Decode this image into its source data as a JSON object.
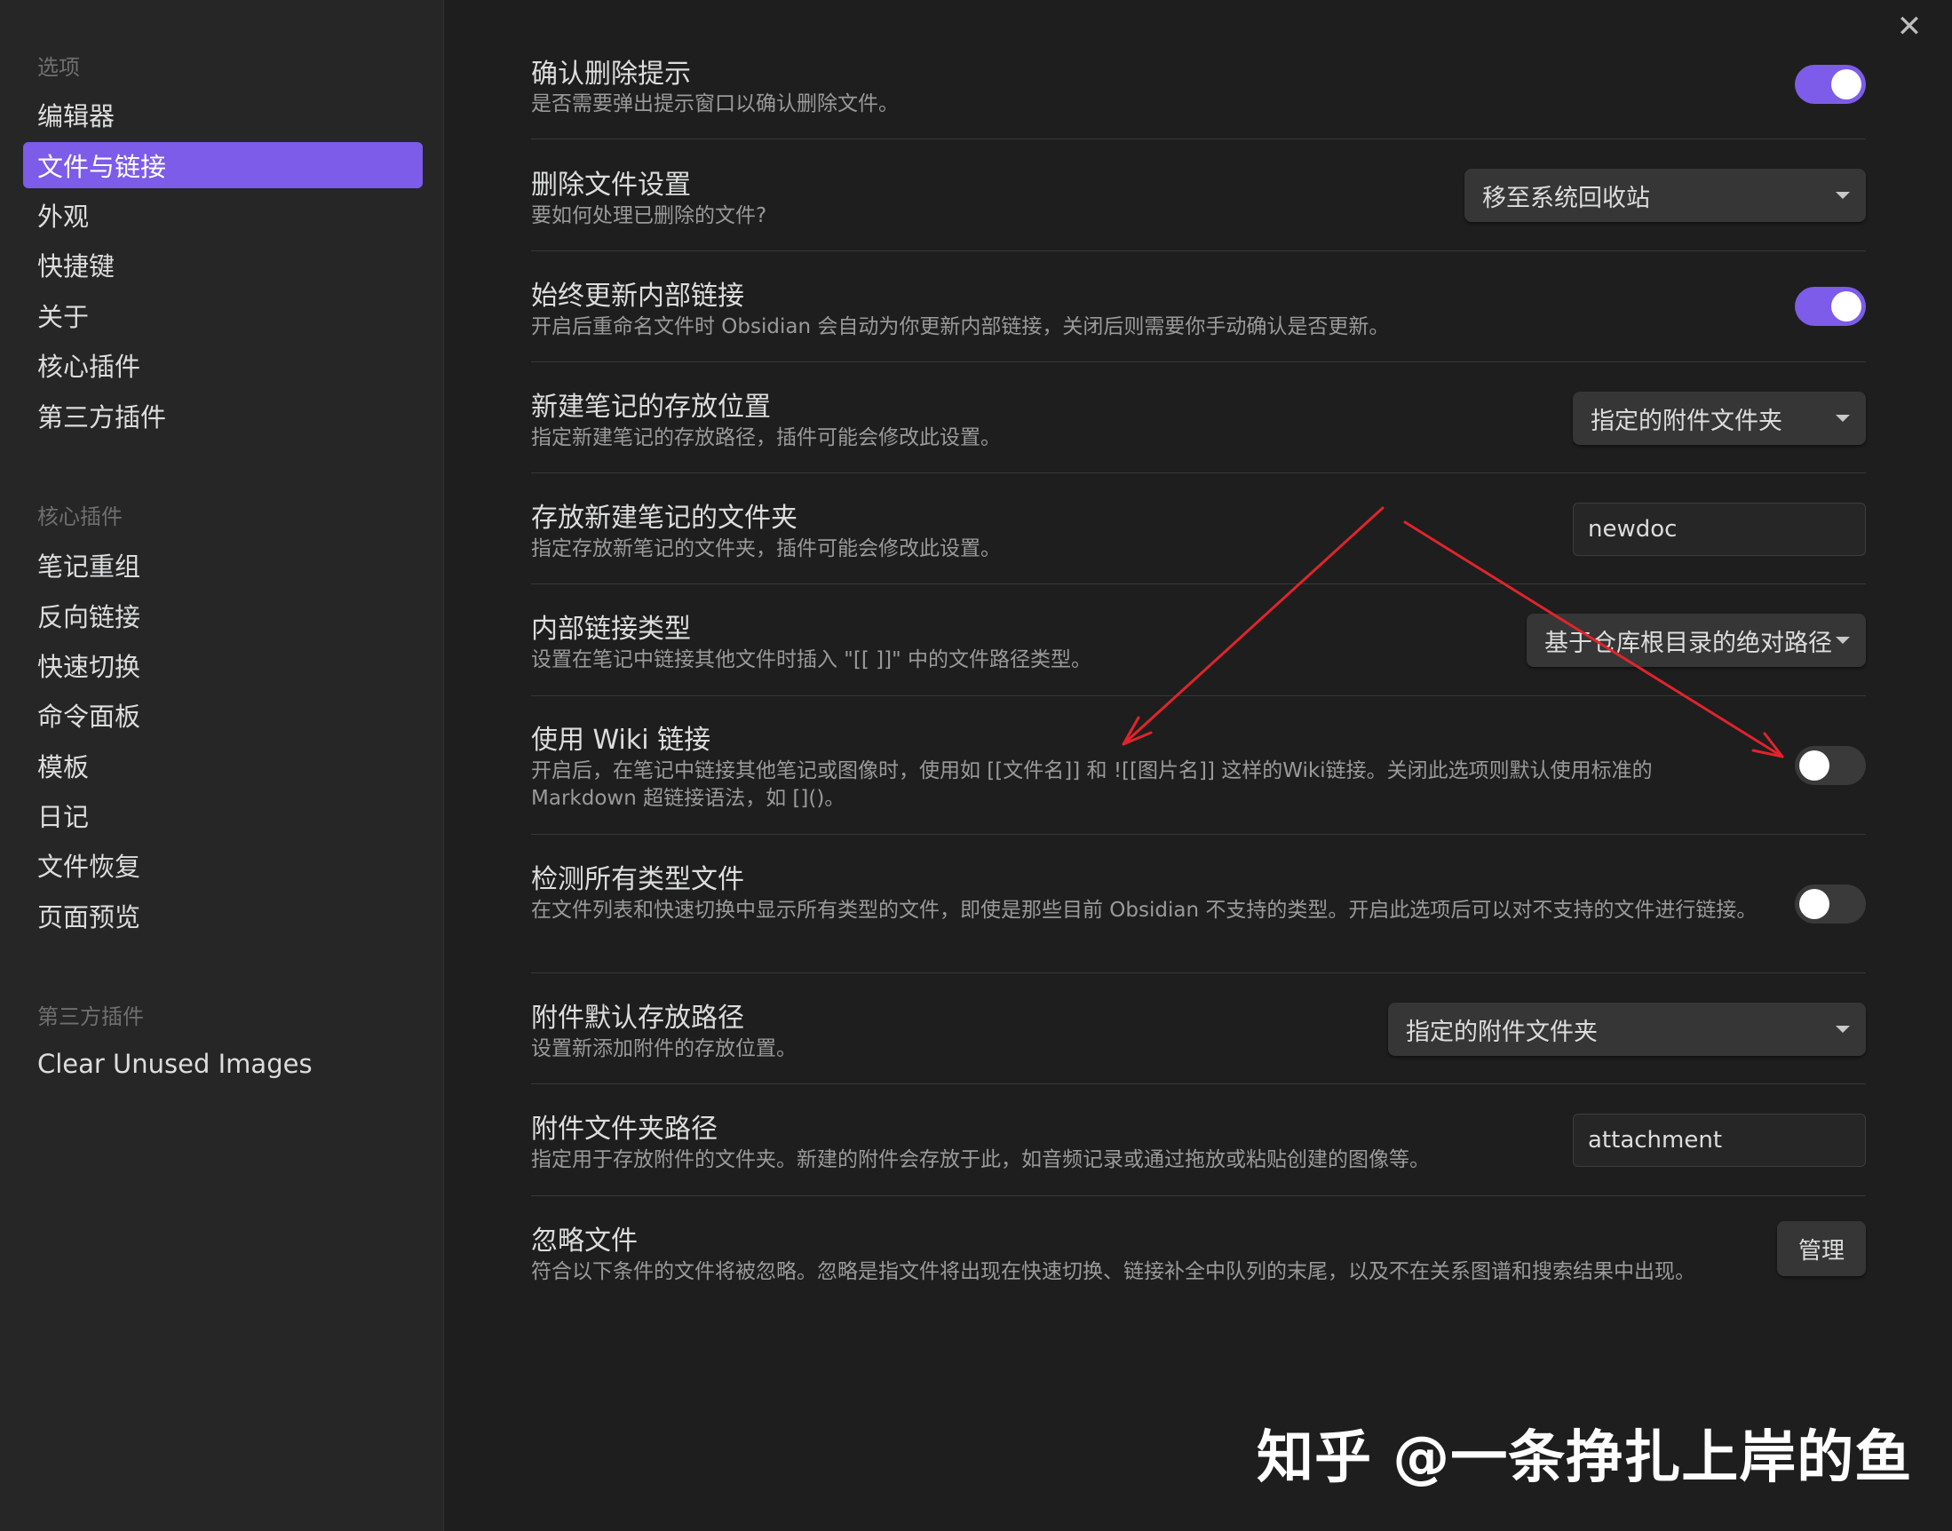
{
  "sidebar": {
    "sections": [
      {
        "title": "选项",
        "items": [
          "编辑器",
          "文件与链接",
          "外观",
          "快捷键",
          "关于",
          "核心插件",
          "第三方插件"
        ]
      },
      {
        "title": "核心插件",
        "items": [
          "笔记重组",
          "反向链接",
          "快速切换",
          "命令面板",
          "模板",
          "日记",
          "文件恢复",
          "页面预览"
        ]
      },
      {
        "title": "第三方插件",
        "items": [
          "Clear Unused Images"
        ]
      }
    ],
    "active_item": "文件与链接"
  },
  "close_icon": "✕",
  "settings": [
    {
      "name": "确认删除提示",
      "desc": "是否需要弹出提示窗口以确认删除文件。",
      "control": "toggle",
      "state": "on"
    },
    {
      "name": "删除文件设置",
      "desc": "要如何处理已删除的文件?",
      "control": "dropdown",
      "value": "移至系统回收站"
    },
    {
      "name": "始终更新内部链接",
      "desc": "开启后重命名文件时 Obsidian 会自动为你更新内部链接，关闭后则需要你手动确认是否更新。",
      "control": "toggle",
      "state": "on"
    },
    {
      "name": "新建笔记的存放位置",
      "desc": "指定新建笔记的存放路径，插件可能会修改此设置。",
      "control": "dropdown",
      "value": "指定的附件文件夹"
    },
    {
      "name": "存放新建笔记的文件夹",
      "desc": "指定存放新笔记的文件夹，插件可能会修改此设置。",
      "control": "text",
      "value": "newdoc"
    },
    {
      "name": "内部链接类型",
      "desc": "设置在笔记中链接其他文件时插入 \"[[ ]]\" 中的文件路径类型。",
      "control": "dropdown",
      "value": "基于仓库根目录的绝对路径"
    },
    {
      "name": "使用 Wiki 链接",
      "desc": "开启后，在笔记中链接其他笔记或图像时，使用如 [[文件名]] 和 ![[图片名]] 这样的Wiki链接。关闭此选项则默认使用标准的 Markdown 超链接语法，如 []()。",
      "control": "toggle",
      "state": "off"
    },
    {
      "name": "检测所有类型文件",
      "desc": "在文件列表和快速切换中显示所有类型的文件，即使是那些目前 Obsidian 不支持的类型。开启此选项后可以对不支持的文件进行链接。",
      "control": "toggle",
      "state": "off"
    },
    {
      "name": "附件默认存放路径",
      "desc": "设置新添加附件的存放位置。",
      "control": "dropdown",
      "value": "指定的附件文件夹"
    },
    {
      "name": "附件文件夹路径",
      "desc": "指定用于存放附件的文件夹。新建的附件会存放于此，如音频记录或通过拖放或粘贴创建的图像等。",
      "control": "text",
      "value": "attachment"
    },
    {
      "name": "忽略文件",
      "desc": "符合以下条件的文件将被忽略。忽略是指文件将出现在快速切换、链接补全中队列的末尾，以及不在关系图谱和搜索结果中出现。",
      "control": "button",
      "value": "管理"
    }
  ],
  "watermark": "知乎 @一条挣扎上岸的鱼",
  "colors": {
    "accent": "#7c5ce8",
    "annotation": "#e0242c"
  }
}
